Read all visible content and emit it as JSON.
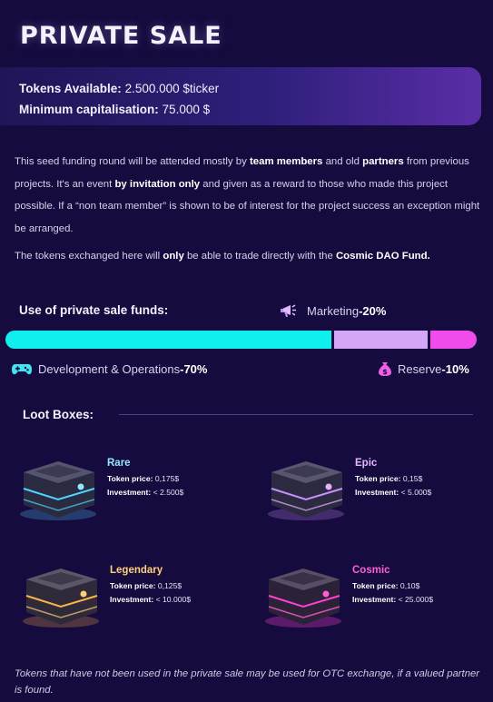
{
  "title": "PRIVATE SALE",
  "tokens_card": {
    "available_label": "Tokens Available:",
    "available_value": "2.500.000 $ticker",
    "min_cap_label": "Minimum capitalisation:",
    "min_cap_value": "75.000 $"
  },
  "intro": {
    "p1_a": "This seed funding round will be attended mostly by ",
    "p1_b": "team members",
    "p1_c": " and old ",
    "p1_d": "partners",
    "p1_e": " from previous projects. It's an event ",
    "p1_f": "by invitation only",
    "p1_g": " and given as a reward to those who made this project possible. If a “non team member” is shown to be of interest for the project success an exception might be arranged.",
    "p2_a": "The tokens exchanged here will ",
    "p2_b": "only",
    "p2_c": " be able to trade directly with the ",
    "p2_d": "Cosmic DAO Fund."
  },
  "funds": {
    "label": "Use of private sale funds:",
    "items": [
      {
        "name": "Development & Operations",
        "sep": " - ",
        "percent": "70%",
        "value": 70,
        "color": "#0ff0ee",
        "icon": "gamepad-icon"
      },
      {
        "name": "Marketing",
        "sep": " - ",
        "percent": "20%",
        "value": 20,
        "color": "#d4a6f6",
        "icon": "megaphone-icon"
      },
      {
        "name": "Reserve",
        "sep": " - ",
        "percent": "10%",
        "value": 10,
        "color": "#f04cec",
        "icon": "money-bag-icon"
      }
    ]
  },
  "loot": {
    "label": "Loot Boxes:",
    "price_label": "Token price:",
    "investment_label": "Investment:",
    "boxes": [
      {
        "name": "Rare",
        "price": "0,175$",
        "investment": "< 2.500$",
        "color": "#8fe9ff",
        "glow": "#4fd4ff"
      },
      {
        "name": "Epic",
        "price": "0,15$",
        "investment": "< 5.000$",
        "color": "#e6b3ff",
        "glow": "#c890ff"
      },
      {
        "name": "Legendary",
        "price": "0,125$",
        "investment": "< 10.000$",
        "color": "#ffd07a",
        "glow": "#ffb347"
      },
      {
        "name": "Cosmic",
        "price": "0,10$",
        "investment": "< 25.000$",
        "color": "#ff5fd6",
        "glow": "#ff3fd0"
      }
    ]
  },
  "footer": "Tokens that have not been used in the private sale may be used for OTC exchange, if a valued partner is found."
}
